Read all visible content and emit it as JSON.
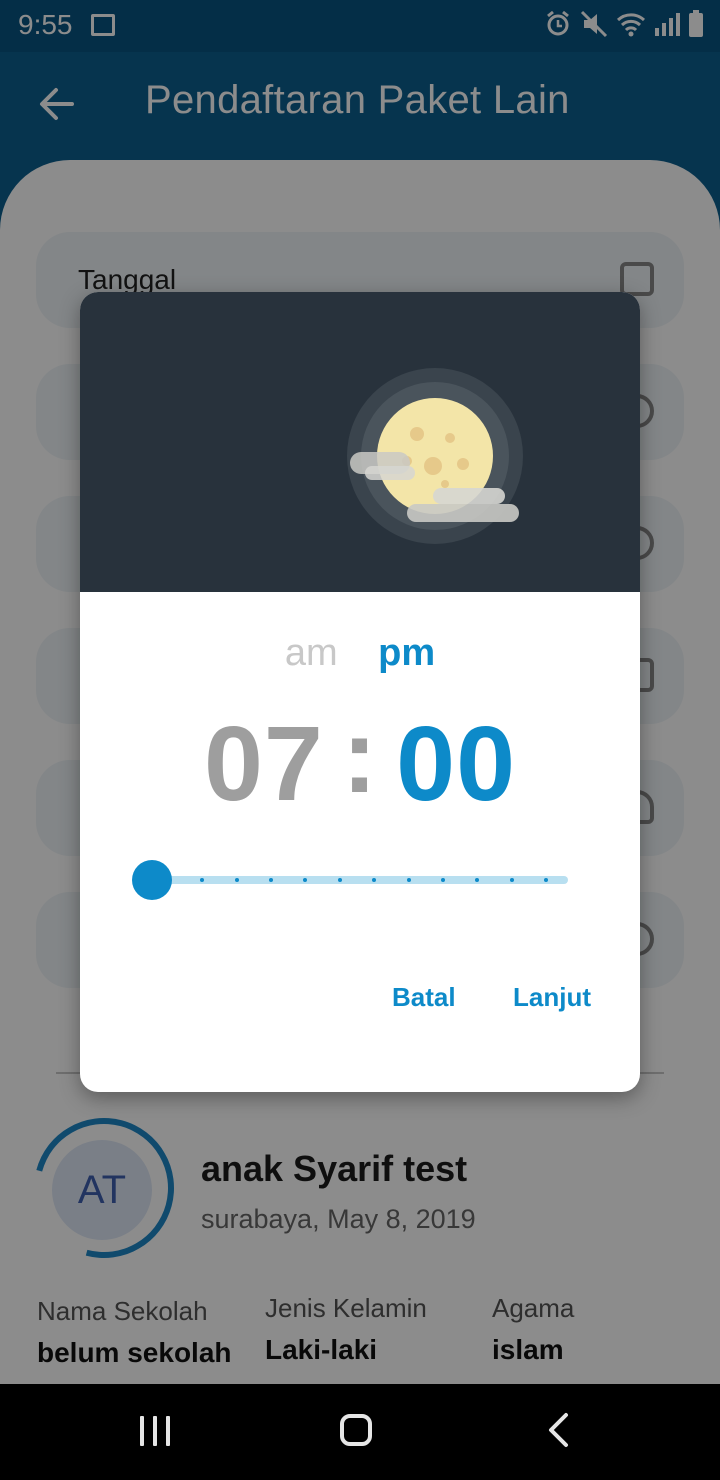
{
  "status_bar": {
    "time": "9:55"
  },
  "app_bar": {
    "title": "Pendaftaran Paket Lain"
  },
  "form": {
    "fields": [
      {
        "label": "Tanggal"
      }
    ]
  },
  "profile": {
    "initials": "AT",
    "name": "anak Syarif test",
    "birth": "surabaya, May 8, 2019",
    "school_label": "Nama Sekolah",
    "school_value": "belum sekolah",
    "gender_label": "Jenis Kelamin",
    "gender_value": "Laki-laki",
    "religion_label": "Agama",
    "religion_value": "islam"
  },
  "time_picker": {
    "am_label": "am",
    "pm_label": "pm",
    "selected_period": "pm",
    "hour": "07",
    "separator": ":",
    "minute": "00",
    "slider_value": 0,
    "cancel_label": "Batal",
    "confirm_label": "Lanjut"
  },
  "colors": {
    "primary": "#0b5f8f",
    "accent": "#0d8ac9",
    "dialog_header": "#28323c"
  }
}
